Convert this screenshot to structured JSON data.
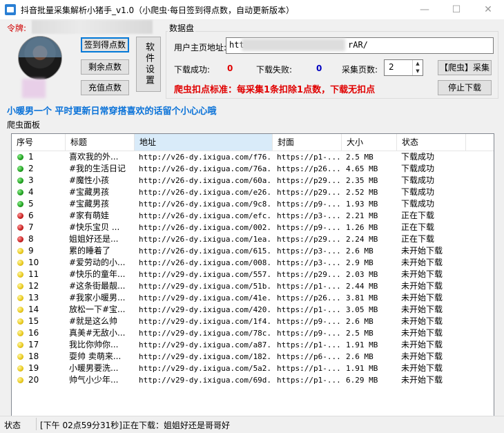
{
  "window": {
    "title": "抖音批量采集解析小猪手_v1.0（小爬虫·每日签到得点数，自动更新版本）",
    "minimize": "—",
    "maximize": "☐",
    "close": "✕"
  },
  "account": {
    "token_label": "令牌:",
    "sign_in_button": "签到得点数",
    "remaining_points_button": "剩余点数",
    "recharge_button": "充值点数",
    "software_settings_button": "软件设置"
  },
  "data_panel": {
    "title": "数据盘",
    "homepage_label": "用户主页地址:",
    "homepage_value": "htt",
    "homepage_value_tail": "rAR/",
    "download_success_label": "下载成功:",
    "download_success_value": "0",
    "download_fail_label": "下载失败:",
    "download_fail_value": "0",
    "pages_label": "采集页数:",
    "pages_value": "2",
    "crawl_button": "【爬虫】采集",
    "stop_button": "停止下载",
    "deduct_standard": "爬虫扣点标准：每采集1条扣除1点数，下载无扣点"
  },
  "profile_slogan": "小暖男一个  平时更新日常穿搭喜欢的话留个小心心哦",
  "crawler_panel_label": "爬虫面板",
  "table": {
    "columns": [
      "序号",
      "标题",
      "地址",
      "封面",
      "大小",
      "状态"
    ],
    "rows": [
      {
        "status_color": "green",
        "no": "1",
        "title": "喜欢我的外...",
        "url": "http://v26-dy.ixigua.com/f76...",
        "cover": "https://p1-...",
        "size": "2.5 MB",
        "status": "下载成功"
      },
      {
        "status_color": "green",
        "no": "2",
        "title": "#我的生活日记",
        "url": "http://v26-dy.ixigua.com/76a...",
        "cover": "https://p26...",
        "size": "4.65 MB",
        "status": "下载成功"
      },
      {
        "status_color": "green",
        "no": "3",
        "title": "#魔性小孩",
        "url": "http://v26-dy.ixigua.com/60a...",
        "cover": "https://p29...",
        "size": "2.35 MB",
        "status": "下载成功"
      },
      {
        "status_color": "green",
        "no": "4",
        "title": "#宝藏男孩",
        "url": "http://v26-dy.ixigua.com/e26...",
        "cover": "https://p29...",
        "size": "2.52 MB",
        "status": "下载成功"
      },
      {
        "status_color": "green",
        "no": "5",
        "title": "#宝藏男孩",
        "url": "http://v26-dy.ixigua.com/9c8...",
        "cover": "https://p9-...",
        "size": "1.93 MB",
        "status": "下载成功"
      },
      {
        "status_color": "red",
        "no": "6",
        "title": "#家有萌娃",
        "url": "http://v26-dy.ixigua.com/efc...",
        "cover": "https://p3-...",
        "size": "2.21 MB",
        "status": "正在下载"
      },
      {
        "status_color": "red",
        "no": "7",
        "title": "#快乐宝贝 ...",
        "url": "http://v26-dy.ixigua.com/002...",
        "cover": "https://p9-...",
        "size": "1.26 MB",
        "status": "正在下载"
      },
      {
        "status_color": "red",
        "no": "8",
        "title": "姐姐好还是...",
        "url": "http://v26-dy.ixigua.com/1ea...",
        "cover": "https://p29...",
        "size": "2.24 MB",
        "status": "正在下载"
      },
      {
        "status_color": "yellow",
        "no": "9",
        "title": "累的睡着了",
        "url": "http://v26-dy.ixigua.com/615...",
        "cover": "https://p3-...",
        "size": "2.6 MB",
        "status": "未开始下载"
      },
      {
        "status_color": "yellow",
        "no": "10",
        "title": "#爱劳动的小...",
        "url": "http://v26-dy.ixigua.com/008...",
        "cover": "https://p3-...",
        "size": "2.9 MB",
        "status": "未开始下载"
      },
      {
        "status_color": "yellow",
        "no": "11",
        "title": "#快乐的童年...",
        "url": "http://v29-dy.ixigua.com/557...",
        "cover": "https://p29...",
        "size": "2.03 MB",
        "status": "未开始下载"
      },
      {
        "status_color": "yellow",
        "no": "12",
        "title": "#这条街最靓...",
        "url": "http://v29-dy.ixigua.com/51b...",
        "cover": "https://p1-...",
        "size": "2.44 MB",
        "status": "未开始下载"
      },
      {
        "status_color": "yellow",
        "no": "13",
        "title": "#我家小暖男...",
        "url": "http://v29-dy.ixigua.com/41e...",
        "cover": "https://p26...",
        "size": "3.81 MB",
        "status": "未开始下载"
      },
      {
        "status_color": "yellow",
        "no": "14",
        "title": "放松一下#宝...",
        "url": "http://v29-dy.ixigua.com/420...",
        "cover": "https://p1-...",
        "size": "3.05 MB",
        "status": "未开始下载"
      },
      {
        "status_color": "yellow",
        "no": "15",
        "title": "#就是这么帅",
        "url": "http://v29-dy.ixigua.com/1f4...",
        "cover": "https://p9-...",
        "size": "2.6 MB",
        "status": "未开始下载"
      },
      {
        "status_color": "yellow",
        "no": "16",
        "title": "真美#无敌小...",
        "url": "http://v29-dy.ixigua.com/78c...",
        "cover": "https://p9-...",
        "size": "2.5 MB",
        "status": "未开始下载"
      },
      {
        "status_color": "yellow",
        "no": "17",
        "title": "我比你帅你...",
        "url": "http://v29-dy.ixigua.com/a87...",
        "cover": "https://p1-...",
        "size": "1.91 MB",
        "status": "未开始下载"
      },
      {
        "status_color": "yellow",
        "no": "18",
        "title": "耍帅 卖萌来...",
        "url": "http://v29-dy.ixigua.com/182...",
        "cover": "https://p6-...",
        "size": "2.6 MB",
        "status": "未开始下载"
      },
      {
        "status_color": "yellow",
        "no": "19",
        "title": "小暖男要洗...",
        "url": "http://v29-dy.ixigua.com/5a2...",
        "cover": "https://p1-...",
        "size": "1.91 MB",
        "status": "未开始下载"
      },
      {
        "status_color": "yellow",
        "no": "20",
        "title": "帅气小少年...",
        "url": "http://v29-dy.ixigua.com/69d...",
        "cover": "https://p1-...",
        "size": "6.29 MB",
        "status": "未开始下载"
      }
    ]
  },
  "statusbar": {
    "label": "状态",
    "message": "[下午 02点59分31秒]正在下载：姐姐好还是哥哥好"
  },
  "colors": {
    "accent_blue": "#0a72d8",
    "alert_red": "#e00000",
    "status_green": "#1e9e1e",
    "status_red": "#c81e1e",
    "status_yellow": "#e8c81a"
  }
}
